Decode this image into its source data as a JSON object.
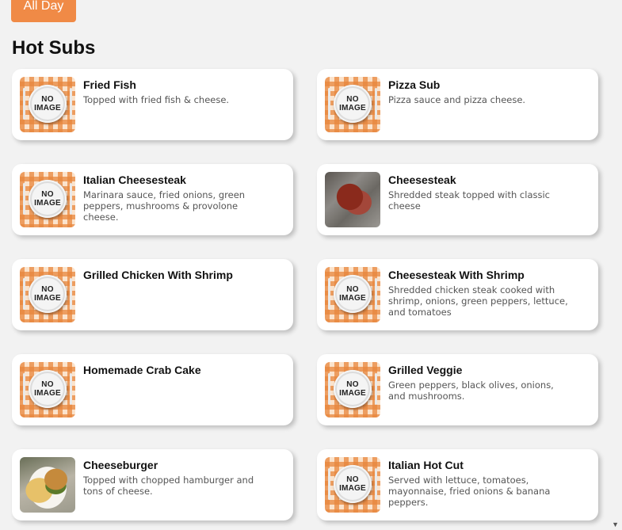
{
  "tab": {
    "label": "All Day"
  },
  "section": {
    "title": "Hot Subs"
  },
  "no_image_text": [
    "NO",
    "IMAGE"
  ],
  "items": [
    {
      "name": "Fried Fish",
      "description": "Topped with fried fish & cheese.",
      "image": "no-image"
    },
    {
      "name": "Pizza Sub",
      "description": "Pizza sauce and pizza cheese.",
      "image": "no-image"
    },
    {
      "name": "Italian Cheesesteak",
      "description": "Marinara sauce, fried onions, green peppers, mushrooms & provolone cheese.",
      "image": "no-image"
    },
    {
      "name": "Cheesesteak",
      "description": "Shredded steak topped with classic cheese",
      "image": "photo-steak"
    },
    {
      "name": "Grilled Chicken With Shrimp",
      "description": "",
      "image": "no-image"
    },
    {
      "name": "Cheesesteak With Shrimp",
      "description": "Shredded chicken steak cooked with shrimp, onions, green peppers, lettuce, and tomatoes",
      "image": "no-image"
    },
    {
      "name": "Homemade Crab Cake",
      "description": "",
      "image": "no-image"
    },
    {
      "name": "Grilled Veggie",
      "description": "Green peppers, black olives, onions, and mushrooms.",
      "image": "no-image"
    },
    {
      "name": "Cheeseburger",
      "description": "Topped with chopped hamburger and tons of cheese.",
      "image": "photo-burger"
    },
    {
      "name": "Italian Hot Cut",
      "description": "Served with lettuce, tomatoes, mayonnaise, fried onions & banana peppers.",
      "image": "no-image"
    }
  ],
  "scroll_indicator": "▼",
  "colors": {
    "accent": "#f08a46",
    "background": "#f2f2f2",
    "card": "#ffffff"
  }
}
